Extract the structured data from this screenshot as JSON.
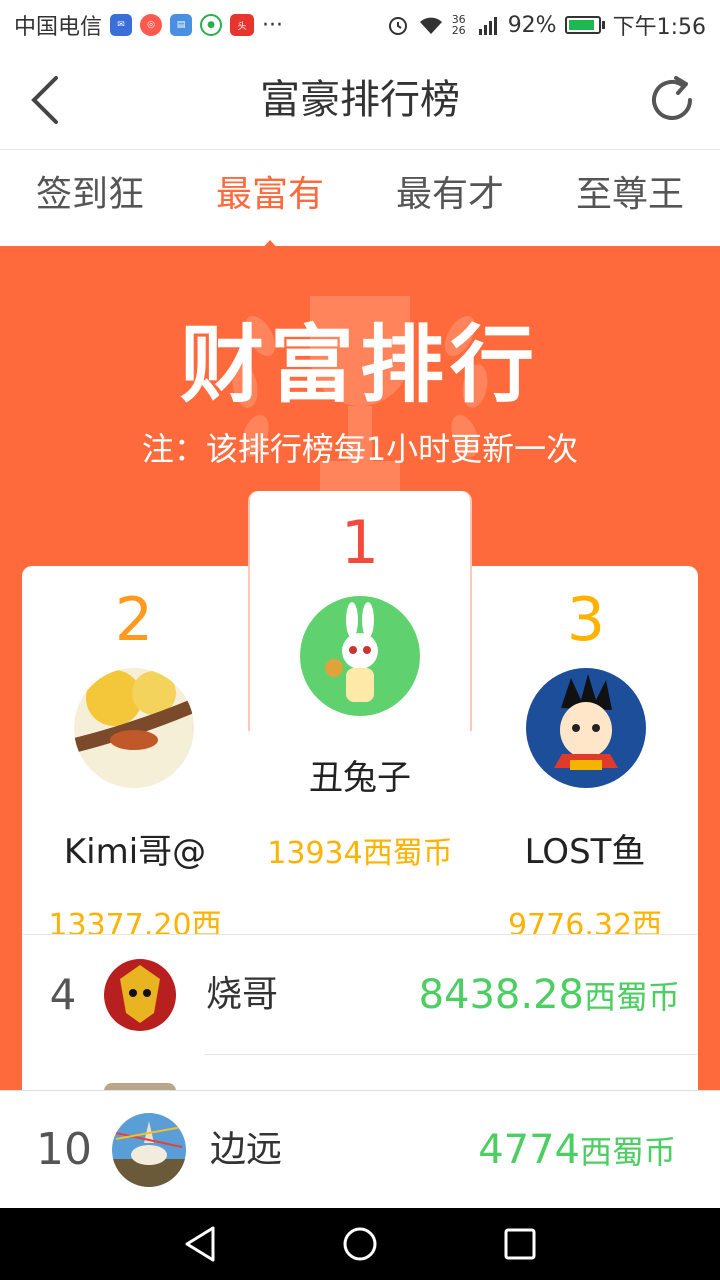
{
  "status_bar": {
    "carrier": "中国电信",
    "network": "36 26",
    "battery_percent": "92%",
    "time": "下午1:56",
    "more": "···"
  },
  "header": {
    "title": "富豪排行榜"
  },
  "tabs": [
    {
      "label": "签到狂",
      "active": false
    },
    {
      "label": "最富有",
      "active": true
    },
    {
      "label": "最有才",
      "active": false
    },
    {
      "label": "至尊王",
      "active": false
    }
  ],
  "banner": {
    "title": "财富排行",
    "note": "注：该排行榜每1小时更新一次"
  },
  "podium": {
    "first": {
      "rank": "1",
      "name": "丑兔子",
      "amount": "13934西蜀币"
    },
    "second": {
      "rank": "2",
      "name": "Kimi哥@",
      "amount": "13377.20西"
    },
    "third": {
      "rank": "3",
      "name": "LOST鱼",
      "amount": "9776.32西"
    }
  },
  "list": [
    {
      "rank": "4",
      "name": "烧哥",
      "amount": "8438.28",
      "unit": "西蜀币"
    }
  ],
  "my_row": {
    "rank": "10",
    "name": "边远",
    "amount": "4774",
    "unit": "西蜀币"
  },
  "colors": {
    "accent": "#ff6a3c",
    "gold": "#ffb300",
    "green": "#4cce62"
  }
}
